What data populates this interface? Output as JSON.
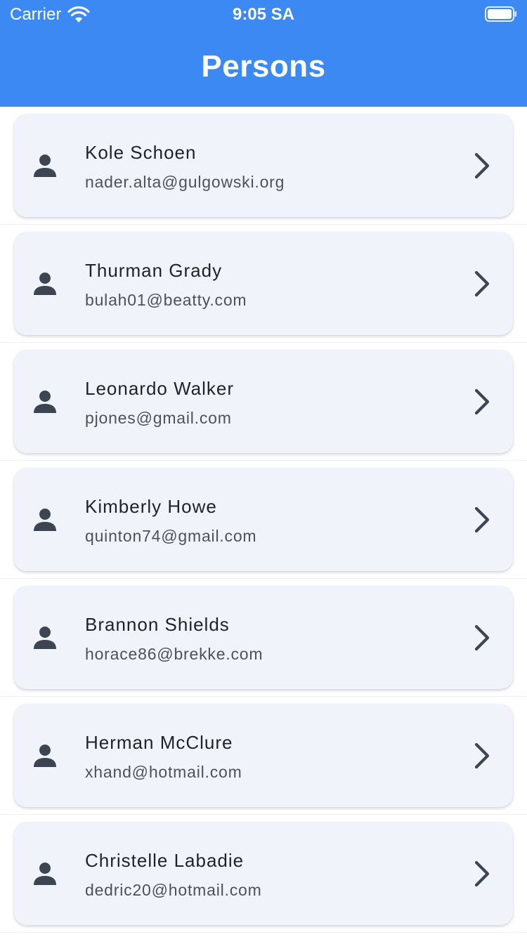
{
  "status_bar": {
    "carrier": "Carrier",
    "time": "9:05 SA",
    "wifi_icon": "wifi-icon",
    "battery_icon": "battery-icon"
  },
  "header": {
    "title": "Persons",
    "background_color": "#3d89f4"
  },
  "persons": [
    {
      "name": "Kole Schoen",
      "email": "nader.alta@gulgowski.org"
    },
    {
      "name": "Thurman Grady",
      "email": "bulah01@beatty.com"
    },
    {
      "name": "Leonardo Walker",
      "email": "pjones@gmail.com"
    },
    {
      "name": "Kimberly Howe",
      "email": "quinton74@gmail.com"
    },
    {
      "name": "Brannon Shields",
      "email": "horace86@brekke.com"
    },
    {
      "name": "Herman McClure",
      "email": "xhand@hotmail.com"
    },
    {
      "name": "Christelle Labadie",
      "email": "dedric20@hotmail.com"
    }
  ],
  "icons": {
    "row_leading": "person-icon",
    "row_trailing": "chevron-right-icon"
  }
}
